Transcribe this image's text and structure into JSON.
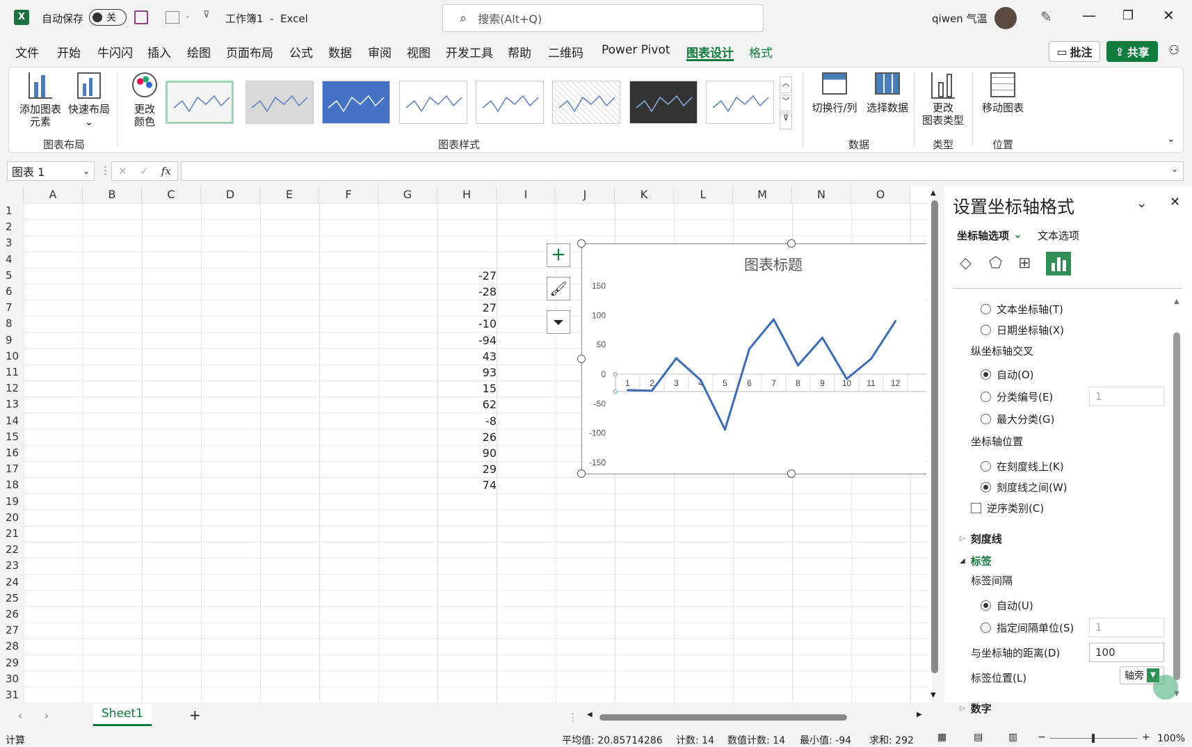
{
  "titlebar": {
    "autosave_label": "自动保存",
    "autosave_state": "关",
    "doc_title": "工作簿1  -  Excel",
    "search_placeholder": "搜索(Alt+Q)",
    "user_name": "qiwen 气温"
  },
  "menu": [
    "文件",
    "开始",
    "牛闪闪",
    "插入",
    "绘图",
    "页面布局",
    "公式",
    "数据",
    "审阅",
    "视图",
    "开发工具",
    "帮助",
    "二维码",
    "Power Pivot",
    "图表设计",
    "格式"
  ],
  "menu_right": {
    "comment": "批注",
    "share": "共享"
  },
  "ribbon": {
    "add_element": [
      "添加图表",
      "元素"
    ],
    "quick_layout": "快速布局",
    "group_layout": "图表布局",
    "change_color": [
      "更改",
      "颜色"
    ],
    "group_styles": "图表样式",
    "switch_row_col": "切换行/列",
    "select_data": "选择数据",
    "group_data": "数据",
    "change_type": [
      "更改",
      "图表类型"
    ],
    "group_type": "类型",
    "move_chart": "移动图表",
    "group_location": "位置"
  },
  "formula_bar": {
    "name_box": "图表 1",
    "fx": "fx"
  },
  "columns": [
    "A",
    "B",
    "C",
    "D",
    "E",
    "F",
    "G",
    "H",
    "I",
    "J",
    "K",
    "L",
    "M",
    "N",
    "O"
  ],
  "rows": [
    1,
    2,
    3,
    4,
    5,
    6,
    7,
    8,
    9,
    10,
    11,
    12,
    13,
    14,
    15,
    16,
    17,
    18,
    19,
    20,
    21,
    22,
    23,
    24,
    25,
    26,
    27,
    28,
    29,
    30,
    31
  ],
  "cells_H": [
    {
      "row": 5,
      "value": "-27"
    },
    {
      "row": 6,
      "value": "-28"
    },
    {
      "row": 7,
      "value": "27"
    },
    {
      "row": 8,
      "value": "-10"
    },
    {
      "row": 9,
      "value": "-94"
    },
    {
      "row": 10,
      "value": "43"
    },
    {
      "row": 11,
      "value": "93"
    },
    {
      "row": 12,
      "value": "15"
    },
    {
      "row": 13,
      "value": "62"
    },
    {
      "row": 14,
      "value": "-8"
    },
    {
      "row": 15,
      "value": "26"
    },
    {
      "row": 16,
      "value": "90"
    },
    {
      "row": 17,
      "value": "29"
    },
    {
      "row": 18,
      "value": "74"
    }
  ],
  "chart_data": {
    "type": "line",
    "title": "图表标题",
    "categories": [
      "1",
      "2",
      "3",
      "4",
      "5",
      "6",
      "7",
      "8",
      "9",
      "10",
      "11",
      "12"
    ],
    "series": [
      {
        "values": [
          -27,
          -28,
          27,
          -10,
          -94,
          43,
          93,
          15,
          62,
          -8,
          26,
          90
        ]
      }
    ],
    "ylim": [
      -150,
      150
    ],
    "yticks": [
      150,
      100,
      50,
      0,
      -50,
      -100,
      -150
    ],
    "line_color": "#3a6bb5"
  },
  "pane": {
    "title": "设置坐标轴格式",
    "tab_axis": "坐标轴选项",
    "tab_text": "文本选项",
    "opt_text_axis": "文本坐标轴(T)",
    "opt_date_axis": "日期坐标轴(X)",
    "cross_header": "纵坐标轴交叉",
    "cross_auto": "自动(O)",
    "cross_cat": "分类编号(E)",
    "cross_cat_val": "1",
    "cross_max": "最大分类(G)",
    "pos_header": "坐标轴位置",
    "pos_on": "在刻度线上(K)",
    "pos_between": "刻度线之间(W)",
    "reverse": "逆序类别(C)",
    "ticks": "刻度线",
    "labels": "标签",
    "interval_header": "标签间隔",
    "interval_auto": "自动(U)",
    "interval_spec": "指定间隔单位(S)",
    "interval_val": "1",
    "distance_label": "与坐标轴的距离(D)",
    "distance_val": "100",
    "label_pos": "标签位置(L)",
    "label_pos_val": "轴旁",
    "number": "数字"
  },
  "sheet_tab": "Sheet1",
  "status": {
    "mode": "计算",
    "avg": "平均值: 20.85714286",
    "count": "计数: 14",
    "numcount": "数值计数: 14",
    "min": "最小值: -94",
    "sum": "求和: 292",
    "zoom": "100%"
  },
  "colors": {
    "accent": "#117a3d",
    "chart_line": "#3a6bb5"
  }
}
